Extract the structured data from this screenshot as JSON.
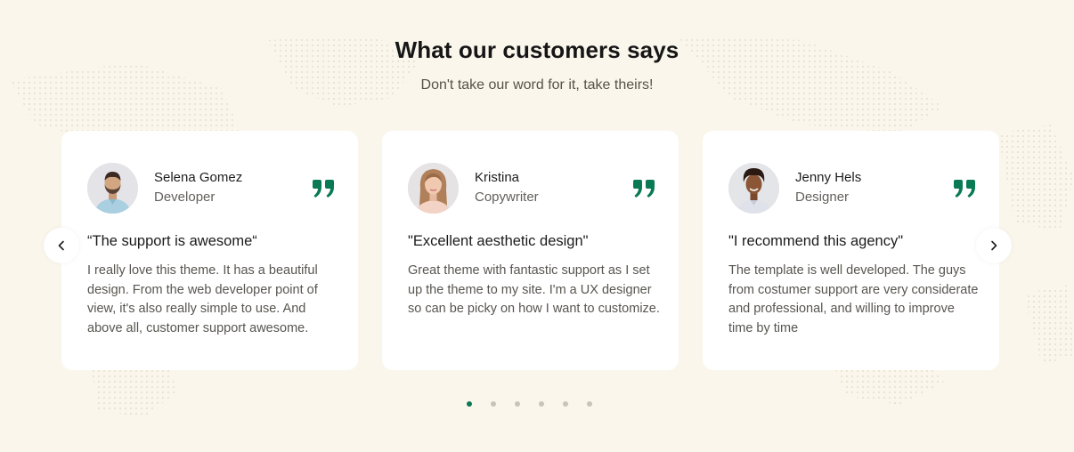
{
  "section": {
    "title": "What our customers says",
    "subtitle": "Don't take our word for it, take theirs!"
  },
  "colors": {
    "background": "#faf6ec",
    "accent": "#0a7a55",
    "card": "#ffffff"
  },
  "testimonials": [
    {
      "name": "Selena Gomez",
      "role": "Developer",
      "title": "“The support is awesome“",
      "body": "I really love this theme. It has a beautiful design. From the web developer point of view, it's also really simple to use. And above all, customer support awesome."
    },
    {
      "name": "Kristina",
      "role": "Copywriter",
      "title": "\"Excellent aesthetic design\"",
      "body": "Great theme with fantastic support as I set up the theme to my site. I'm a UX designer so can be picky on how I want to customize."
    },
    {
      "name": "Jenny Hels",
      "role": "Designer",
      "title": "\"I recommend this agency\"",
      "body": "The template is well developed. The guys from costumer support are very considerate and professional, and willing to improve time by time"
    }
  ],
  "icons": {
    "quote": "quote-icon",
    "prev": "chevron-left-icon",
    "next": "chevron-right-icon"
  },
  "pagination": {
    "total": 6,
    "active": 1
  }
}
